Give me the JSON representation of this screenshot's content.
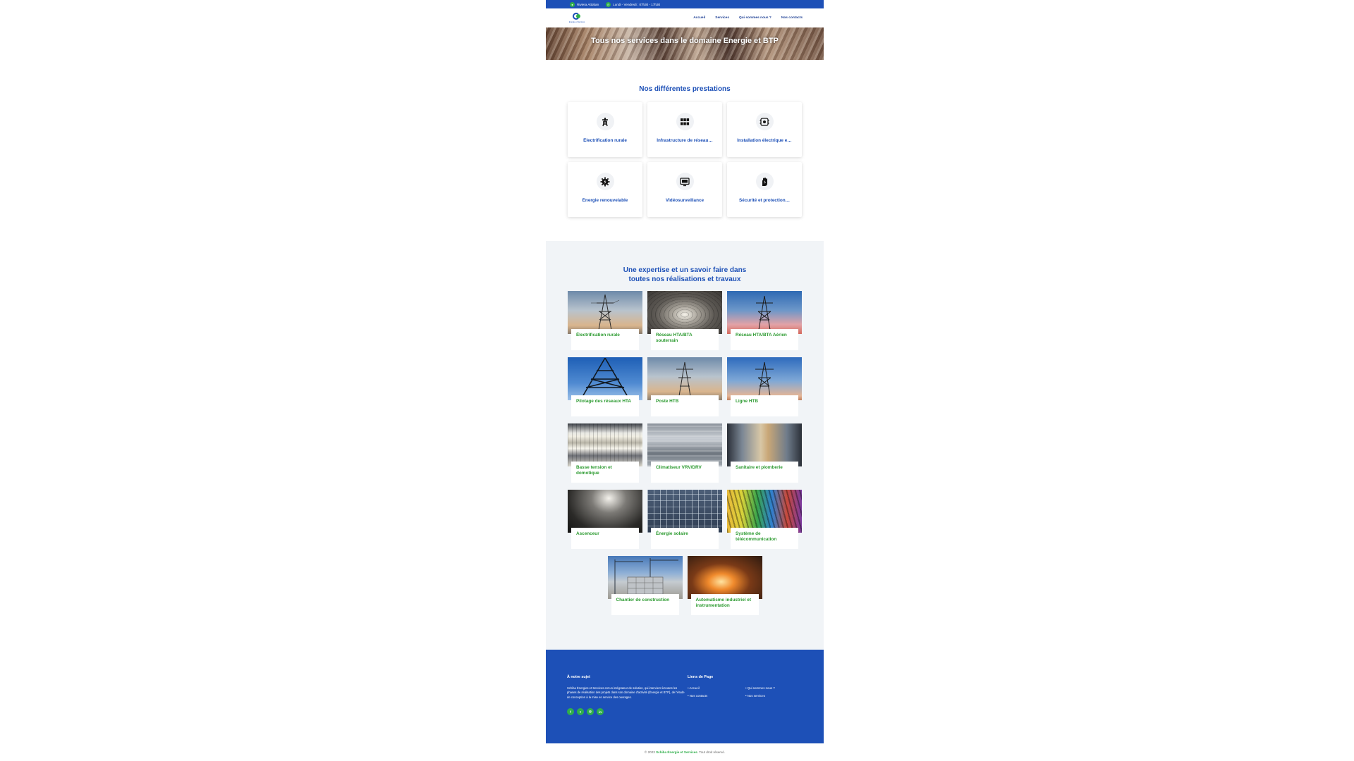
{
  "topbar": {
    "location": "Riviera Attoban",
    "hours": "Lundi - Vendredi : 07h30 - 17h30"
  },
  "nav": {
    "logo_text": "Energie et Services",
    "links": [
      "Accueil",
      "Services",
      "Qui sommes nous ?",
      "Nos contacts"
    ]
  },
  "hero": {
    "title": "Tous nos services dans le domaine Energie et BTP"
  },
  "prestations": {
    "title": "Nos différentes prestations",
    "items": [
      {
        "label": "Électrification rurale",
        "icon": "power-tower-icon"
      },
      {
        "label": "Infrastructure de réseau…",
        "icon": "network-infrastructure-icon"
      },
      {
        "label": "Installation électrique e…",
        "icon": "electrical-installation-icon"
      },
      {
        "label": "Énergie renouvelable",
        "icon": "renewable-gear-icon"
      },
      {
        "label": "Vidéosurveillance",
        "icon": "monitor-icon"
      },
      {
        "label": "Sécurité et protection…",
        "icon": "hand-shield-icon"
      }
    ]
  },
  "expertise": {
    "title": "Une expertise et un savoir faire dans toutes nos réalisations et travaux",
    "items": [
      {
        "label": "Électrification rurale"
      },
      {
        "label": "Réseau HTA/BTA souterrain"
      },
      {
        "label": "Réseau HTA/BTA Aérien"
      },
      {
        "label": "Pilotage des réseaux HTA"
      },
      {
        "label": "Poste HTB"
      },
      {
        "label": "Ligne HTB"
      },
      {
        "label": "Basse tension et domotique"
      },
      {
        "label": "Climatiseur VRV/DRV"
      },
      {
        "label": "Sanitaire et plomberie"
      },
      {
        "label": "Ascenceur"
      },
      {
        "label": "Énergie solaire"
      },
      {
        "label": "Système de télécommunication"
      },
      {
        "label": "Chantier de construction"
      },
      {
        "label": "Automatisme industriel et instrumentation"
      }
    ]
  },
  "footer": {
    "about_title": "À notre sujet",
    "about_text": "Schiba Énergies et Services est un intégrateur de solution, qui intervient à toutes les phases de réalisation des projets dans son domaine d'activité (Énergie et BTP), de l'étude de conception à la mise en service des ouvrages.",
    "social": [
      "f",
      "t",
      "◎",
      "in"
    ],
    "links_title": "Liens de Page",
    "links": [
      "• Accueil",
      "• Qui sommes nous ?",
      "• Nos contacts",
      "• Nos services"
    ]
  },
  "copyright": {
    "prefix": "© 2023",
    "brand": "Schiba Énergie et Services",
    "suffix": ". Tout droit réservé."
  },
  "colors": {
    "primary": "#1d50b7",
    "accent": "#2fae4a",
    "section_bg": "#f1f4f7"
  }
}
